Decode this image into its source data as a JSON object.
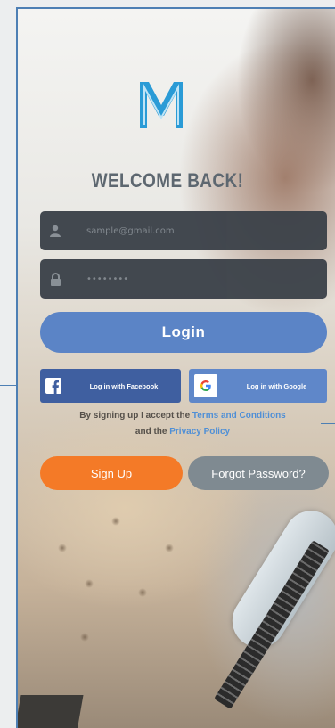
{
  "brand": {
    "logo_letter": "M",
    "accent": "#2a9bd6"
  },
  "heading": "WELCOME BACK!",
  "email": {
    "placeholder": "sample@gmail.com",
    "icon": "user-icon"
  },
  "password": {
    "placeholder": "••••••••",
    "icon": "lock-icon"
  },
  "login_label": "Login",
  "facebook_label": "Log in with Facebook",
  "google_label": "Log in with Google",
  "terms": {
    "prefix": "By signing up I accept the ",
    "terms_link": "Terms and Conditions",
    "middle": "and the ",
    "privacy_link": "Privacy Policy"
  },
  "signup_label": "Sign Up",
  "forgot_label": "Forgot Password?",
  "colors": {
    "login": "#5b84c6",
    "facebook": "#3f5fa0",
    "google": "#5f87c9",
    "signup": "#f47a27",
    "forgot": "#7f8a91",
    "field": "#3a4048"
  }
}
